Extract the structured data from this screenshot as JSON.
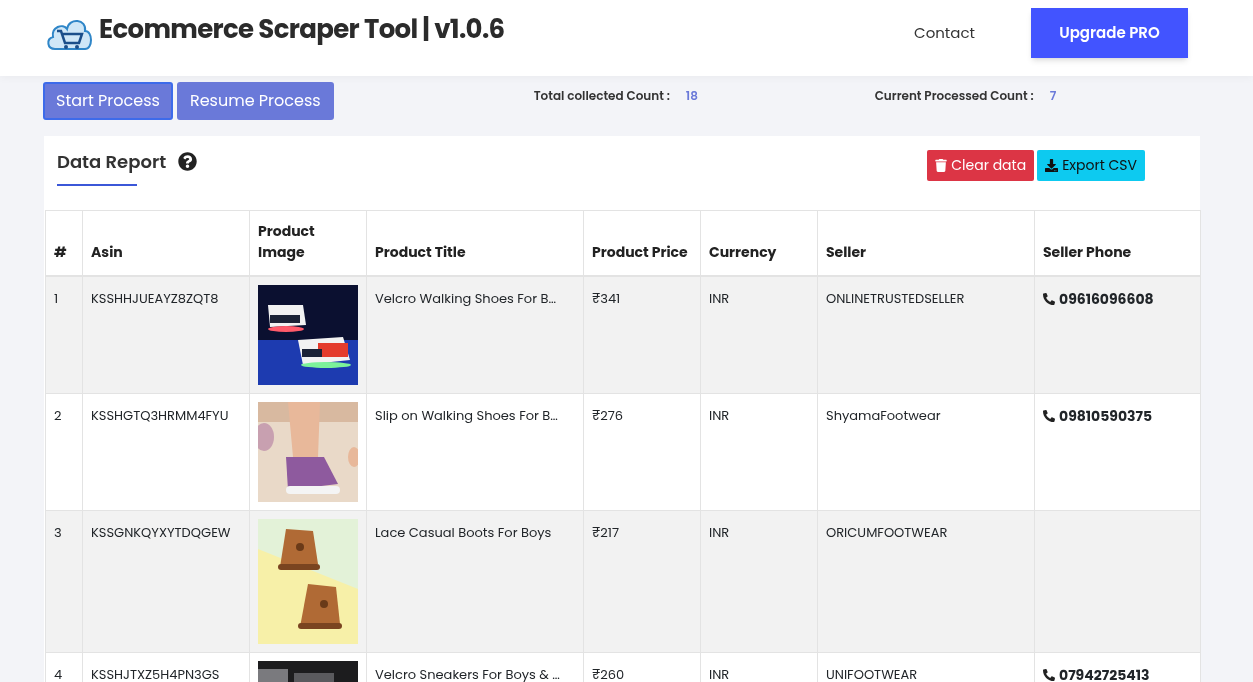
{
  "header": {
    "title": "Ecommerce Scraper Tool | v1.0.6",
    "nav_link": "Contact",
    "upgrade_button": "Upgrade PRO"
  },
  "actions": [
    "Start Process",
    "Resume Process"
  ],
  "counts": [
    {
      "label": "Total collected Count :",
      "value": "18"
    },
    {
      "label": "Current Processed Count :",
      "value": "7"
    }
  ],
  "report": {
    "title": "Data Report",
    "clear_button": "Clear data",
    "export_button": "Export CSV"
  },
  "table": {
    "columns": [
      "#",
      "Asin",
      "Product Image",
      "Product Title",
      "Product Price",
      "Currency",
      "Seller",
      "Seller Phone"
    ],
    "rows": [
      {
        "index": "1",
        "asin": "KSSHHJUEAYZ8ZQT8",
        "title": "Velcro Walking Shoes For B…",
        "price": "₹341",
        "currency": "INR",
        "seller": "ONLINETRUSTEDSELLER",
        "phone": "09616096608"
      },
      {
        "index": "2",
        "asin": "KSSHGTQ3HRMM4FYU",
        "title": "Slip on Walking Shoes For B…",
        "price": "₹276",
        "currency": "INR",
        "seller": "ShyamaFootwear",
        "phone": "09810590375"
      },
      {
        "index": "3",
        "asin": "KSSGNKQYXYTDQGEW",
        "title": "Lace Casual Boots For Boys",
        "price": "₹217",
        "currency": "INR",
        "seller": "ORICUMFOOTWEAR"
      },
      {
        "index": "4",
        "asin": "KSSHJTXZ5H4PN3GS",
        "title": "Velcro Sneakers For Boys & …",
        "price": "₹260",
        "currency": "INR",
        "seller": "UNIFOOTWEAR",
        "phone": "07942725413"
      }
    ]
  }
}
